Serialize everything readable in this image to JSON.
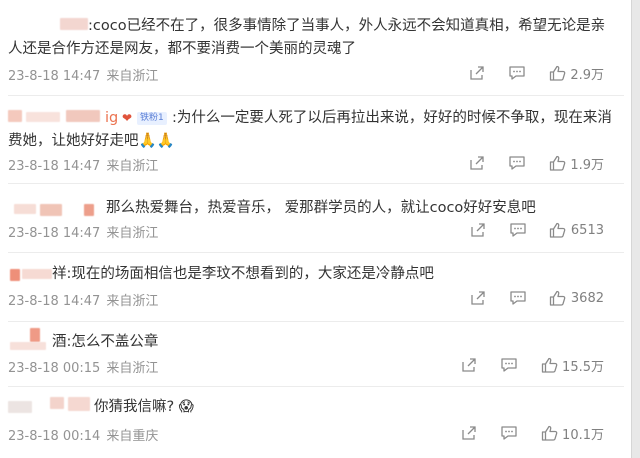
{
  "colors": {
    "author": "#eb7350",
    "meta": "#939393",
    "divider": "#ececec",
    "badge_bg": "#e8f0ff"
  },
  "comments": [
    {
      "lines": [
        ":coco已经不在了，很多事情除了当事人，外人永远不会知道真相，希望无论是亲",
        "人还是合作方还是网友，都不要消费一个美丽的灵魂了"
      ],
      "time": "23-8-18 14:47",
      "location": "来自浙江",
      "likes": "2.9万"
    },
    {
      "author_suffix": "ig",
      "badge": "铁粉1",
      "lines": [
        ":为什么一定要人死了以后再拉出来说，好好的时候不争取，现在来消",
        "费她，让她好好走吧🙏🙏"
      ],
      "time": "23-8-18 14:47",
      "location": "来自浙江",
      "likes": "1.9万"
    },
    {
      "lines": [
        "那么热爱舞台，热爱音乐，  爱那群学员的人，就让coco好好安息吧"
      ],
      "time": "23-8-18 14:47",
      "location": "来自浙江",
      "likes": "6513"
    },
    {
      "lines": [
        "祥:现在的场面相信也是李玟不想看到的，大家还是冷静点吧"
      ],
      "time": "23-8-18 14:47",
      "location": "来自浙江",
      "likes": "3682"
    },
    {
      "lines": [
        "酒:怎么不盖公章"
      ],
      "time": "23-8-18 00:15",
      "location": "来自浙江",
      "likes": "15.5万"
    },
    {
      "lines": [
        "你猜我信嘛? 😱"
      ],
      "time": "23-8-18 00:14",
      "location": "来自重庆",
      "likes": "10.1万"
    }
  ],
  "icons": {
    "share": "share-icon",
    "comment": "comment-icon",
    "like": "like-icon"
  }
}
